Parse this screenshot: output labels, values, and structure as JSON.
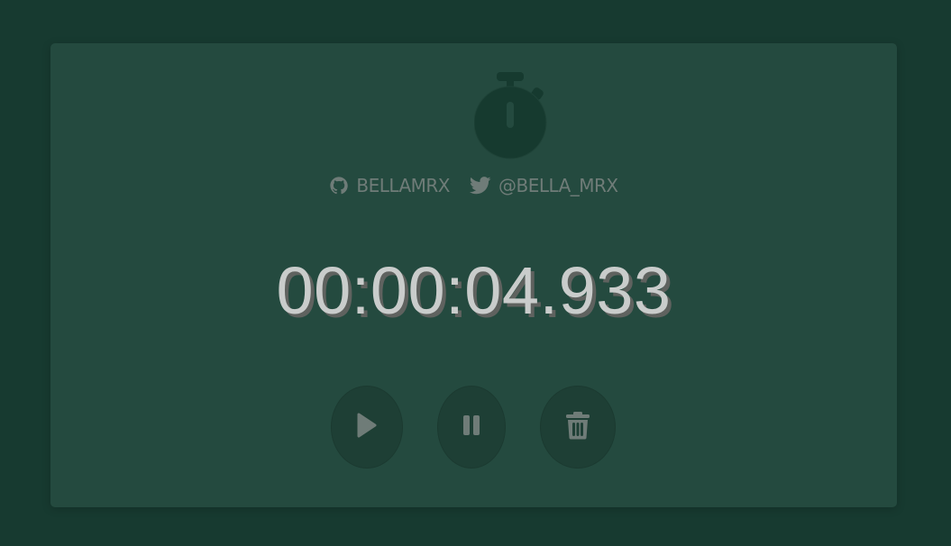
{
  "header": {
    "icon": "stopwatch-icon"
  },
  "links": {
    "github": {
      "icon": "github-icon",
      "label": "bellamrx"
    },
    "twitter": {
      "icon": "twitter-icon",
      "label": "@bella_mrx"
    }
  },
  "timer": {
    "display": "00:00:04.933"
  },
  "controls": {
    "start_icon": "play-icon",
    "pause_icon": "pause-icon",
    "reset_icon": "trash-icon"
  },
  "colors": {
    "background": "#173a30",
    "card": "#244a3f",
    "button": "#1e3f35",
    "icon_dark": "#163a2f",
    "text_muted": "#6f7c78",
    "time_text": "#c9cccb"
  }
}
